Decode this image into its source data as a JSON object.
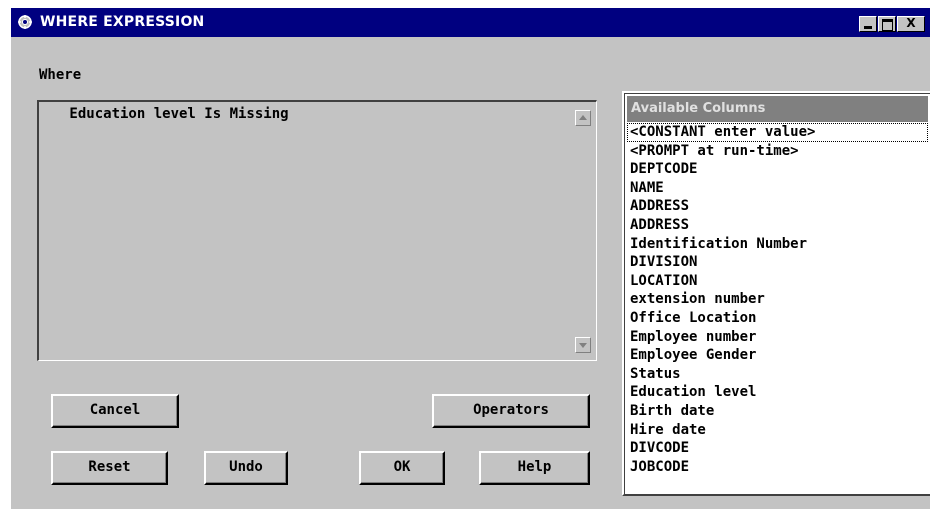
{
  "window": {
    "title": "WHERE EXPRESSION",
    "controls": {
      "minimize": "_",
      "maximize": "□",
      "close": "X"
    }
  },
  "where": {
    "label": "Where",
    "expression": " Education level Is Missing"
  },
  "buttons": {
    "cancel": "Cancel",
    "operators": "Operators",
    "reset": "Reset",
    "undo": "Undo",
    "ok": "OK",
    "help": "Help"
  },
  "columns": {
    "header": "Available Columns",
    "items": [
      "<CONSTANT enter value>",
      "<PROMPT at run-time>",
      "DEPTCODE",
      "NAME",
      "ADDRESS",
      "ADDRESS",
      "Identification Number",
      "DIVISION",
      "LOCATION",
      "extension number",
      "Office Location",
      "Employee number",
      "Employee Gender",
      "Status",
      "Education level",
      "Birth date",
      "Hire date",
      "DIVCODE",
      "JOBCODE"
    ]
  },
  "colors": {
    "titlebar": "#000080",
    "dialog_bg": "#c3c3c3",
    "list_header": "#808080"
  }
}
